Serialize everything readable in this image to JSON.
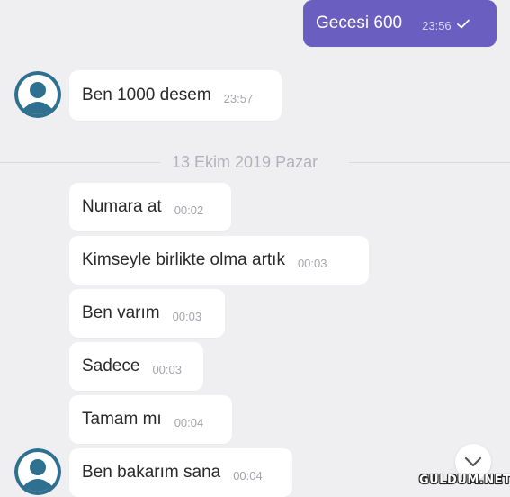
{
  "colors": {
    "background": "#efeff1",
    "incoming_bubble": "#ffffff",
    "outgoing_bubble": "#6a5fc0",
    "avatar": "#2f6f8f"
  },
  "messages": [
    {
      "direction": "outgoing",
      "text": "Gecesi 600",
      "time": "23:56",
      "status_icon": "checkmark-icon"
    },
    {
      "direction": "incoming",
      "text": "Ben 1000 desem",
      "time": "23:57"
    },
    {
      "direction": "incoming",
      "text": "Numara at",
      "time": "00:02"
    },
    {
      "direction": "incoming",
      "text": "Kimseyle birlikte olma artık",
      "time": "00:03"
    },
    {
      "direction": "incoming",
      "text": "Ben varım",
      "time": "00:03"
    },
    {
      "direction": "incoming",
      "text": "Sadece",
      "time": "00:03"
    },
    {
      "direction": "incoming",
      "text": "Tamam mı",
      "time": "00:04"
    },
    {
      "direction": "incoming",
      "text": "Ben bakarım sana",
      "time": "00:04"
    }
  ],
  "date_separator": "13 Ekim 2019 Pazar",
  "scroll_button_icon": "chevron-down-icon",
  "watermark": "GULDUM.NET"
}
